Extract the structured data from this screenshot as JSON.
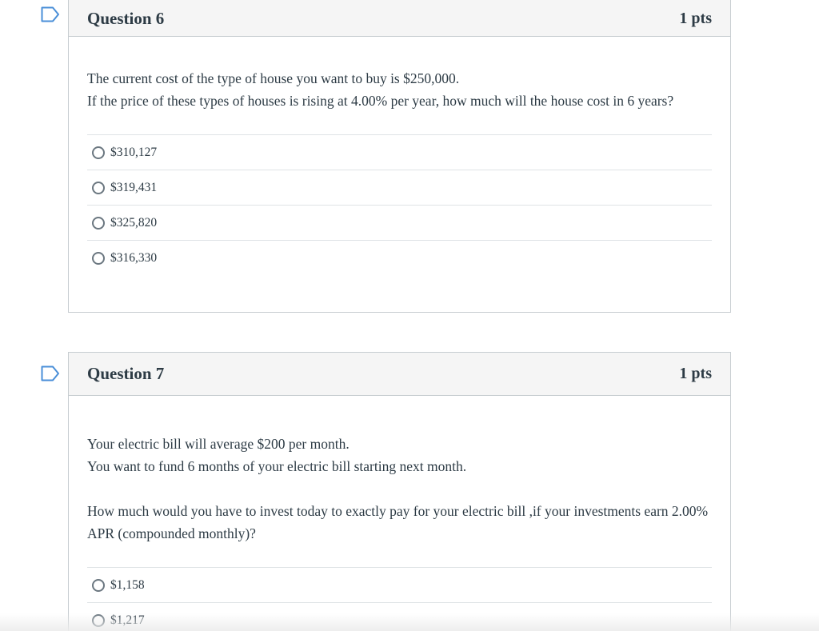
{
  "questions": [
    {
      "title": "Question 6",
      "points": "1 pts",
      "text_lines": [
        "The current cost of the type of house you want to buy is $250,000.",
        "If the price of these types of houses is rising at 4.00% per year, how much will the house cost in 6 years?"
      ],
      "answers": [
        "$310,127",
        "$319,431",
        "$325,820",
        "$316,330"
      ],
      "icon": "flag-icon"
    },
    {
      "title": "Question 7",
      "points": "1 pts",
      "text_lines": [
        "Your electric bill will average $200 per month.",
        "You want to fund 6 months of your electric bill starting next month."
      ],
      "text_paragraph": "How much would you have to invest today to exactly pay for your electric bill ,if your investments earn 2.00% APR (compounded monthly)?",
      "answers": [
        "$1,158",
        "$1,217"
      ],
      "icon": "flag-icon"
    }
  ],
  "colors": {
    "flag": "#4a8fd8",
    "header_bg": "#f5f5f5",
    "border": "#c7cdd1",
    "text": "#2d3b45"
  }
}
